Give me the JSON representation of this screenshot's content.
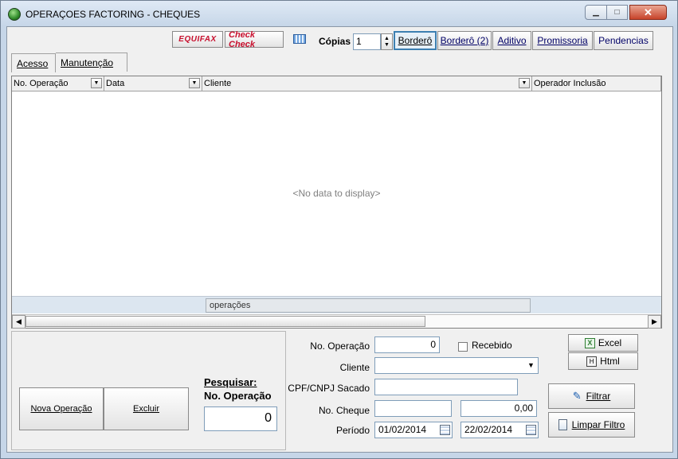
{
  "window": {
    "title": "OPERAÇOES FACTORING - CHEQUES",
    "min_glyph": "▁",
    "max_glyph": "□",
    "close_glyph": "✕"
  },
  "toolbar": {
    "equifax_label": "EQUIFAX",
    "checkcheck_label": "Check Check",
    "copias_label": "Cópias",
    "copias_value": "1",
    "spin_up": "▲",
    "spin_down": "▼",
    "bordero_label": "Borderô",
    "bordero2_label": "Borderô (2)",
    "aditivo_label": "Aditivo",
    "promissoria_label": "Promissoria",
    "pendencias_label": "Pendencias"
  },
  "tabs": [
    {
      "label": "Acesso"
    },
    {
      "label": "Manutenção"
    }
  ],
  "grid": {
    "columns": [
      {
        "label": "No. Operação"
      },
      {
        "label": "Data"
      },
      {
        "label": "Cliente"
      },
      {
        "label": "Operador Inclusão"
      }
    ],
    "dropdown_glyph": "▼",
    "empty_text": "<No data to display>",
    "footer_label": "operações",
    "scroll_left": "◀",
    "scroll_right": "▶"
  },
  "actions": {
    "nova_operacao": "Nova Operação",
    "excluir": "Excluir",
    "pesquisar_line1": "Pesquisar:",
    "pesquisar_line2": "No. Operação",
    "pesquisar_value": "0"
  },
  "filters": {
    "no_operacao_label": "No. Operação",
    "no_operacao_value": "0",
    "recebido_label": "Recebido",
    "cliente_label": "Cliente",
    "cliente_value": "",
    "cpf_label": "CPF/CNPJ Sacado",
    "cpf_value": "",
    "no_cheque_label": "No. Cheque",
    "no_cheque_value": "",
    "valor_value": "0,00",
    "periodo_label": "Período",
    "periodo_inicio": "01/02/2014",
    "periodo_fim": "22/02/2014"
  },
  "export": {
    "excel_label": "Excel",
    "html_label": "Html",
    "filtrar_label": "Filtrar",
    "limpar_label": "Limpar Filtro"
  }
}
